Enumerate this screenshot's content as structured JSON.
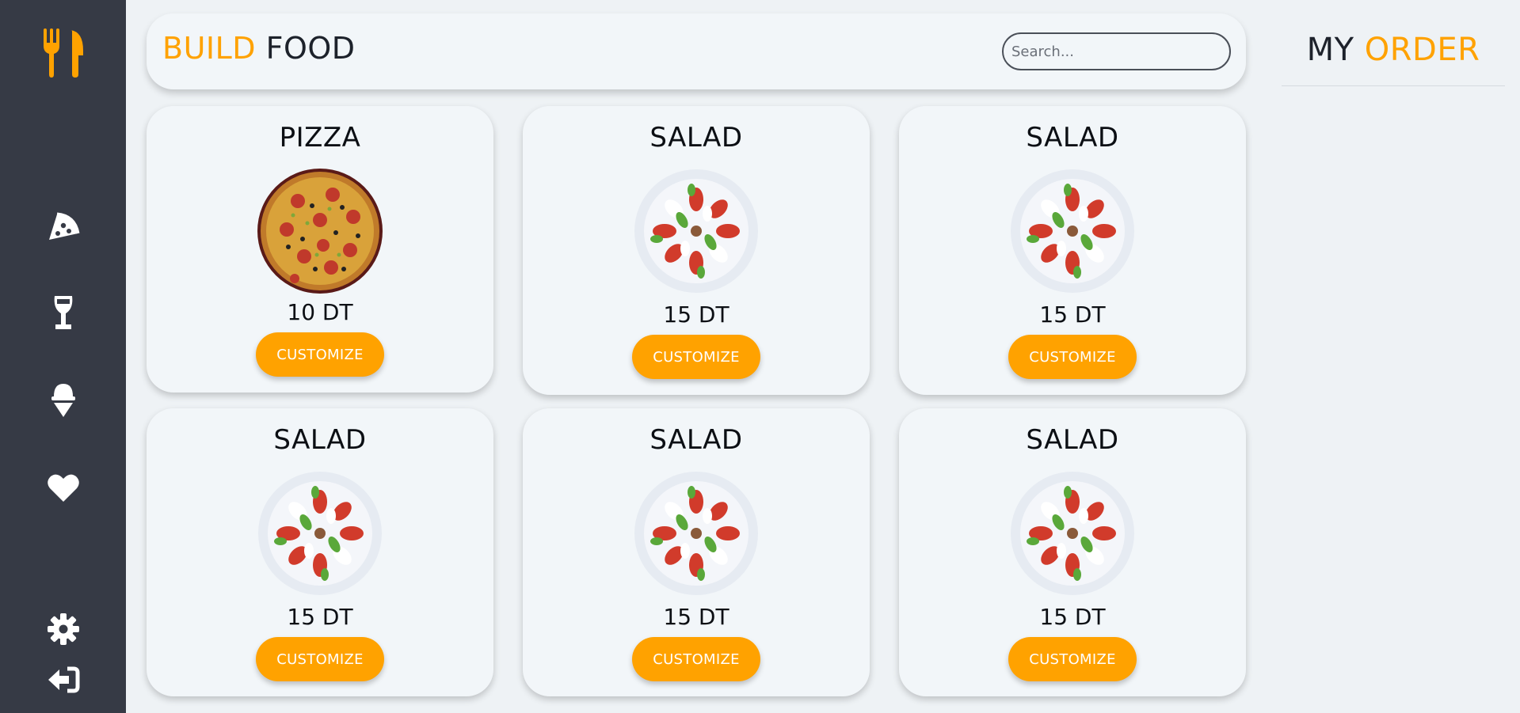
{
  "brand": {
    "part1": "BUILD",
    "part2": "FOOD"
  },
  "search": {
    "placeholder": "Search..."
  },
  "order": {
    "title_part1": "MY",
    "title_part2": "ORDER"
  },
  "sidebar": {
    "items": [
      {
        "icon": "utensils-icon"
      },
      {
        "icon": "pizza-icon"
      },
      {
        "icon": "wine-glass-icon"
      },
      {
        "icon": "ice-cream-icon"
      },
      {
        "icon": "heart-icon"
      },
      {
        "icon": "gear-icon"
      },
      {
        "icon": "logout-icon"
      }
    ]
  },
  "colors": {
    "accent": "#ffa200",
    "sidebar": "#363a45",
    "background": "#eef2f5",
    "card": "#f2f6f9"
  },
  "cards": [
    {
      "title": "PIZZA",
      "price": "10 DT",
      "button": "CUSTOMIZE",
      "image": "pizza"
    },
    {
      "title": "SALAD",
      "price": "15 DT",
      "button": "CUSTOMIZE",
      "image": "salad"
    },
    {
      "title": "SALAD",
      "price": "15 DT",
      "button": "CUSTOMIZE",
      "image": "salad"
    },
    {
      "title": "SALAD",
      "price": "15 DT",
      "button": "CUSTOMIZE",
      "image": "salad"
    },
    {
      "title": "SALAD",
      "price": "15 DT",
      "button": "CUSTOMIZE",
      "image": "salad"
    },
    {
      "title": "SALAD",
      "price": "15 DT",
      "button": "CUSTOMIZE",
      "image": "salad"
    }
  ]
}
